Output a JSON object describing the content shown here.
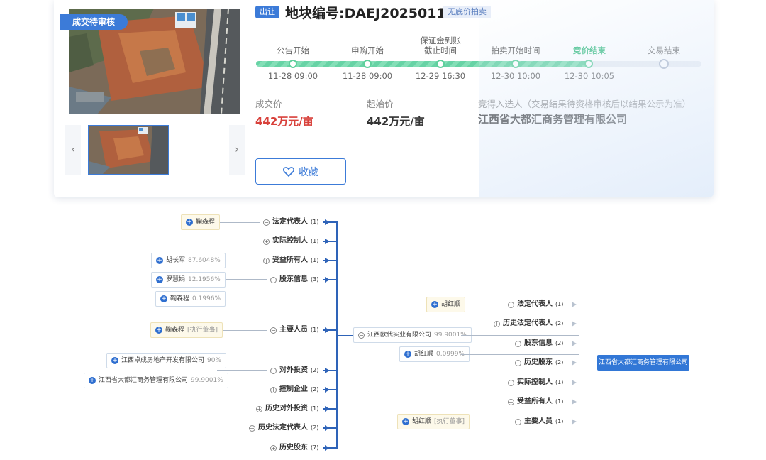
{
  "listing": {
    "status_ribbon": "成交待审核",
    "deal_tag": "出让",
    "title": "地块编号:DAEJ2025011",
    "reserve_tag": "无底价拍卖",
    "nav_prev": "‹",
    "nav_next": "›",
    "steps": [
      {
        "label": "公告开始",
        "time": "11-28 09:00"
      },
      {
        "label": "申购开始",
        "time": "11-28 09:00"
      },
      {
        "label": "保证金到账截止时间",
        "label_line1": "保证金到账",
        "label_line2": "截止时间",
        "time": "12-29 16:30"
      },
      {
        "label": "拍卖开始时间",
        "time": "12-30 10:00"
      },
      {
        "label": "竞价结束",
        "time": "12-30 10:05"
      },
      {
        "label": "交易结束",
        "time": ""
      }
    ],
    "deal_price_label": "成交价",
    "deal_price": "442万元/亩",
    "start_price_label": "起始价",
    "start_price": "442万元/亩",
    "winner_label": "竞得入选人（交易结果待资格审核后以结果公示为准）",
    "winner": "江西省大都汇商务管理有限公司",
    "favorite_label": "收藏",
    "colors": {
      "accent": "#3c7bd8",
      "progress": "#67d3a5",
      "price": "#d8413b"
    }
  },
  "graph": {
    "left": {
      "categories": [
        {
          "label": "法定代表人",
          "count": "(1)",
          "toggle": "−"
        },
        {
          "label": "实际控制人",
          "count": "(1)",
          "toggle": "+"
        },
        {
          "label": "受益所有人",
          "count": "(1)",
          "toggle": "+"
        },
        {
          "label": "股东信息",
          "count": "(3)",
          "toggle": "−"
        },
        {
          "label": "主要人员",
          "count": "(1)",
          "toggle": "−"
        },
        {
          "label": "对外投资",
          "count": "(2)",
          "toggle": "−"
        },
        {
          "label": "控制企业",
          "count": "(2)",
          "toggle": "+"
        },
        {
          "label": "历史对外投资",
          "count": "(1)",
          "toggle": "+"
        },
        {
          "label": "历史法定代表人",
          "count": "(2)",
          "toggle": "+"
        },
        {
          "label": "历史股东",
          "count": "(7)",
          "toggle": "+"
        }
      ],
      "legal_rep": {
        "name": "鞠森程"
      },
      "shareholders": [
        {
          "name": "胡长军",
          "pct": "87.6048%"
        },
        {
          "name": "罗慧娟",
          "pct": "12.1956%"
        },
        {
          "name": "鞠森程",
          "pct": "0.1996%"
        }
      ],
      "key_person": {
        "name": "鞠森程",
        "role": "[执行董事]"
      },
      "investments": [
        {
          "name": "江西卓成房地产开发有限公司",
          "pct": "90%"
        },
        {
          "name": "江西省大都汇商务管理有限公司",
          "pct": "99.9001%"
        }
      ]
    },
    "center": {
      "company": {
        "name": "江西欧代实业有限公司",
        "pct": "99.9001%"
      },
      "person": {
        "name": "胡红顺",
        "pct": "0.0999%"
      }
    },
    "right": {
      "categories": [
        {
          "label": "法定代表人",
          "count": "(1)",
          "toggle": "−"
        },
        {
          "label": "历史法定代表人",
          "count": "(2)",
          "toggle": "+"
        },
        {
          "label": "股东信息",
          "count": "(2)",
          "toggle": "−"
        },
        {
          "label": "历史股东",
          "count": "(2)",
          "toggle": "+"
        },
        {
          "label": "实际控制人",
          "count": "(1)",
          "toggle": "+"
        },
        {
          "label": "受益所有人",
          "count": "(1)",
          "toggle": "+"
        },
        {
          "label": "主要人员",
          "count": "(1)",
          "toggle": "−"
        }
      ],
      "legal_rep": {
        "name": "胡红顺"
      },
      "key_person": {
        "name": "胡红顺",
        "role": "[执行董事]"
      },
      "target_company": "江西省大都汇商务管理有限公司"
    }
  }
}
